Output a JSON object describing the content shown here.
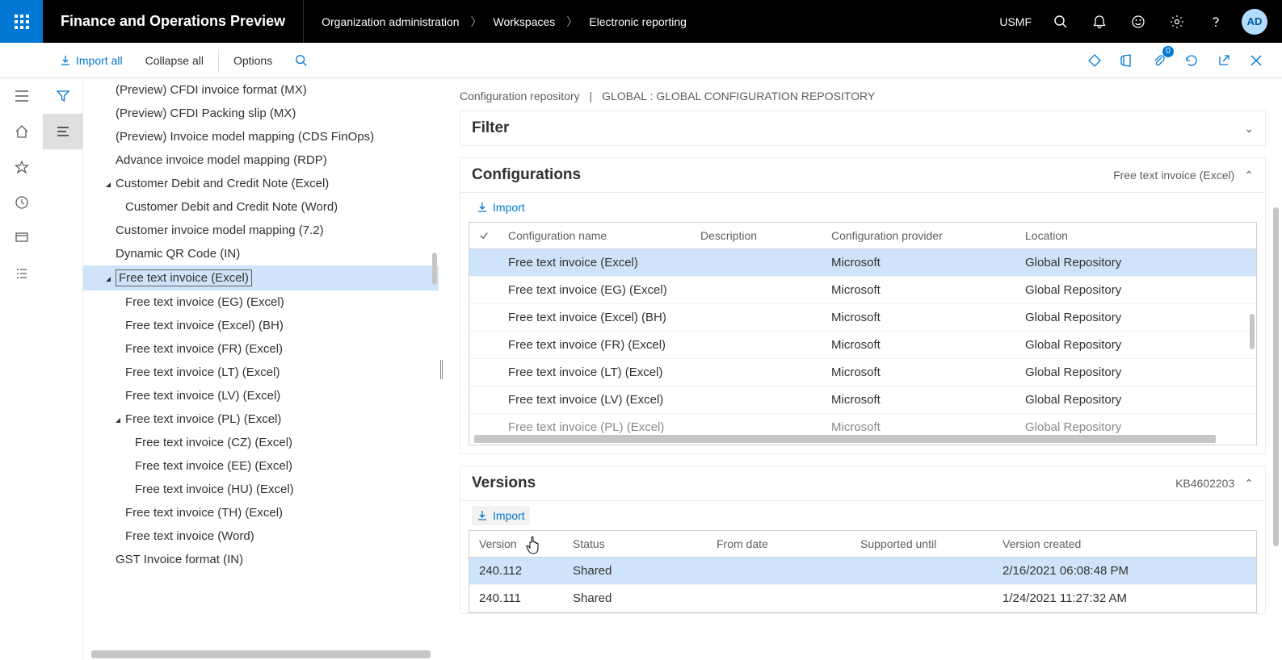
{
  "header": {
    "app_title": "Finance and Operations Preview",
    "breadcrumb": [
      "Organization administration",
      "Workspaces",
      "Electronic reporting"
    ],
    "company": "USMF",
    "avatar": "AD",
    "attach_badge": "0"
  },
  "command_bar": {
    "import_all": "Import all",
    "collapse_all": "Collapse all",
    "options": "Options"
  },
  "tree": [
    {
      "label": "(Preview) CFDI invoice format (MX)",
      "indent": 156,
      "caret": ""
    },
    {
      "label": "(Preview) CFDI Packing slip (MX)",
      "indent": 156,
      "caret": ""
    },
    {
      "label": "(Preview) Invoice model mapping (CDS FinOps)",
      "indent": 156,
      "caret": ""
    },
    {
      "label": "Advance invoice model mapping (RDP)",
      "indent": 156,
      "caret": ""
    },
    {
      "label": "Customer Debit and Credit Note (Excel)",
      "indent": 156,
      "caret": "▾"
    },
    {
      "label": "Customer Debit and Credit Note (Word)",
      "indent": 168,
      "caret": ""
    },
    {
      "label": "Customer invoice model mapping (7.2)",
      "indent": 156,
      "caret": ""
    },
    {
      "label": "Dynamic QR Code (IN)",
      "indent": 156,
      "caret": ""
    },
    {
      "label": "Free text invoice (Excel)",
      "indent": 156,
      "caret": "▾",
      "selected": true
    },
    {
      "label": "Free text invoice (EG) (Excel)",
      "indent": 168,
      "caret": ""
    },
    {
      "label": "Free text invoice (Excel) (BH)",
      "indent": 168,
      "caret": ""
    },
    {
      "label": "Free text invoice (FR) (Excel)",
      "indent": 168,
      "caret": ""
    },
    {
      "label": "Free text invoice (LT) (Excel)",
      "indent": 168,
      "caret": ""
    },
    {
      "label": "Free text invoice (LV) (Excel)",
      "indent": 168,
      "caret": ""
    },
    {
      "label": "Free text invoice (PL) (Excel)",
      "indent": 168,
      "caret": "▾"
    },
    {
      "label": "Free text invoice (CZ) (Excel)",
      "indent": 180,
      "caret": ""
    },
    {
      "label": "Free text invoice (EE) (Excel)",
      "indent": 180,
      "caret": ""
    },
    {
      "label": "Free text invoice (HU) (Excel)",
      "indent": 180,
      "caret": ""
    },
    {
      "label": "Free text invoice (TH) (Excel)",
      "indent": 168,
      "caret": ""
    },
    {
      "label": "Free text invoice (Word)",
      "indent": 168,
      "caret": ""
    },
    {
      "label": "GST Invoice format (IN)",
      "indent": 156,
      "caret": ""
    }
  ],
  "repo": {
    "title": "Configuration repository",
    "name": "GLOBAL : GLOBAL CONFIGURATION REPOSITORY"
  },
  "filter_panel": {
    "title": "Filter"
  },
  "config_panel": {
    "title": "Configurations",
    "subtitle": "Free text invoice (Excel)",
    "import_label": "Import",
    "columns": {
      "name": "Configuration name",
      "desc": "Description",
      "prov": "Configuration provider",
      "loc": "Location"
    },
    "rows": [
      {
        "name": "Free text invoice (Excel)",
        "desc": "",
        "prov": "Microsoft",
        "loc": "Global Repository",
        "selected": true
      },
      {
        "name": "Free text invoice (EG) (Excel)",
        "desc": "",
        "prov": "Microsoft",
        "loc": "Global Repository"
      },
      {
        "name": "Free text invoice (Excel) (BH)",
        "desc": "",
        "prov": "Microsoft",
        "loc": "Global Repository"
      },
      {
        "name": "Free text invoice (FR) (Excel)",
        "desc": "",
        "prov": "Microsoft",
        "loc": "Global Repository"
      },
      {
        "name": "Free text invoice (LT) (Excel)",
        "desc": "",
        "prov": "Microsoft",
        "loc": "Global Repository"
      },
      {
        "name": "Free text invoice (LV) (Excel)",
        "desc": "",
        "prov": "Microsoft",
        "loc": "Global Repository"
      },
      {
        "name": "Free text invoice (PL) (Excel)",
        "desc": "",
        "prov": "Microsoft",
        "loc": "Global Repository",
        "partial": true
      }
    ]
  },
  "versions_panel": {
    "title": "Versions",
    "subtitle": "KB4602203",
    "import_label": "Import",
    "columns": {
      "ver": "Version",
      "status": "Status",
      "from": "From date",
      "supp": "Supported until",
      "created": "Version created"
    },
    "rows": [
      {
        "ver": "240.112",
        "status": "Shared",
        "from": "",
        "supp": "",
        "created": "2/16/2021 06:08:48 PM",
        "selected": true
      },
      {
        "ver": "240.111",
        "status": "Shared",
        "from": "",
        "supp": "",
        "created": "1/24/2021 11:27:32 AM"
      }
    ]
  }
}
